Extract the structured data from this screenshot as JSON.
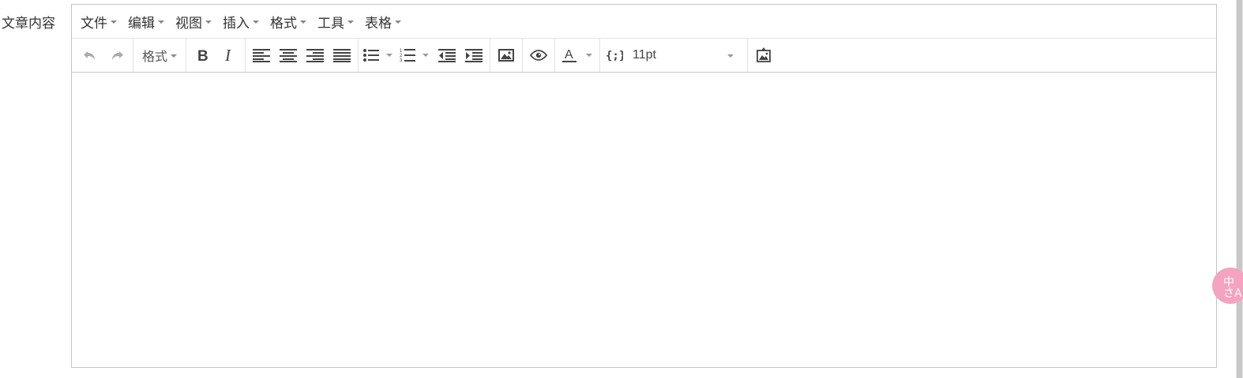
{
  "field_label": "文章内容",
  "menubar": {
    "items": [
      {
        "label": "文件"
      },
      {
        "label": "编辑"
      },
      {
        "label": "视图"
      },
      {
        "label": "插入"
      },
      {
        "label": "格式"
      },
      {
        "label": "工具"
      },
      {
        "label": "表格"
      }
    ]
  },
  "toolbar": {
    "format_label": "格式",
    "font_size": "11pt",
    "icons": [
      "undo-icon",
      "redo-icon",
      "bold-icon",
      "italic-icon",
      "align-left-icon",
      "align-center-icon",
      "align-right-icon",
      "align-justify-icon",
      "bullet-list-icon",
      "numbered-list-icon",
      "outdent-icon",
      "indent-icon",
      "image-icon",
      "preview-icon",
      "text-color-icon",
      "code-sample-icon",
      "image-upload-icon"
    ]
  },
  "ime_badge": {
    "text_line1": "中",
    "text_line2": "さA"
  },
  "colors": {
    "border": "#c5c5c5",
    "icon": "#444444",
    "icon_disabled": "#aaaaaa",
    "ime_badge": "#f4a3c0"
  }
}
